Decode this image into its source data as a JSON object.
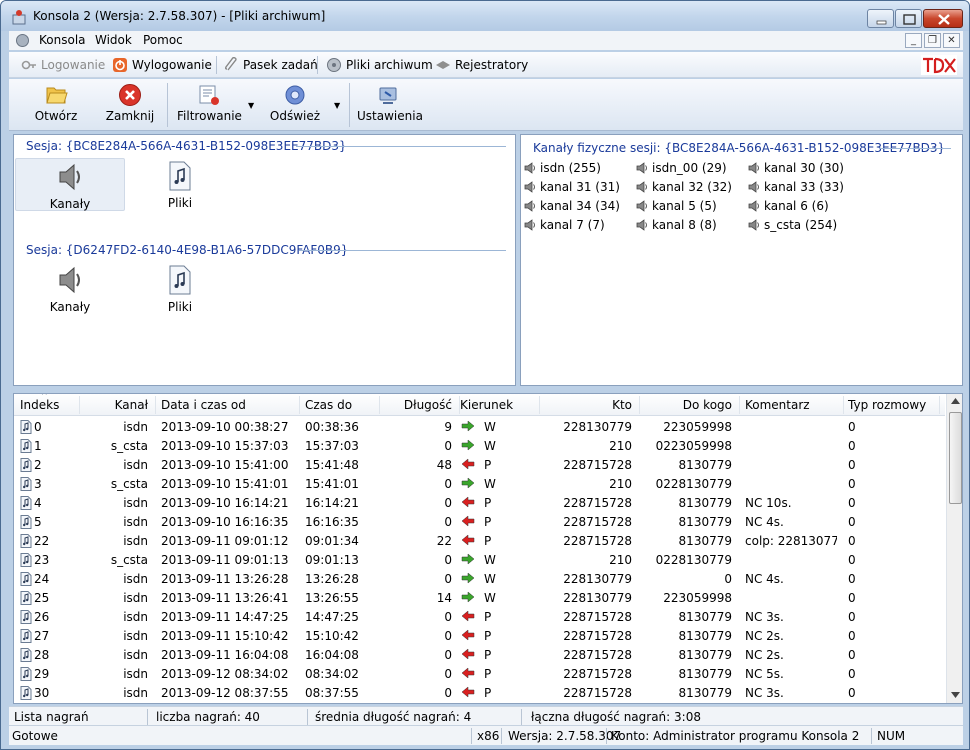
{
  "window": {
    "title": "Konsola 2 (Wersja:  2.7.58.307) - [Pliki archiwum]"
  },
  "menu": {
    "items": [
      "Konsola",
      "Widok",
      "Pomoc"
    ]
  },
  "toolbar1": {
    "login": "Logowanie",
    "logout": "Wylogowanie",
    "taskbar": "Pasek zadań",
    "archive": "Pliki archiwum",
    "recorders": "Rejestratory"
  },
  "toolbar2": {
    "open": "Otwórz",
    "close": "Zamknij",
    "filter": "Filtrowanie",
    "refresh": "Odśwież",
    "settings": "Ustawienia"
  },
  "sessions": [
    {
      "header": "Sesja: {BC8E284A-566A-4631-B152-098E3EE77BD3}",
      "channels": "Kanały",
      "files": "Pliki"
    },
    {
      "header": "Sesja: {D6247FD2-6140-4E98-B1A6-57DDC9FAF0B9}",
      "channels": "Kanały",
      "files": "Pliki"
    }
  ],
  "physical": {
    "header": "Kanały fizyczne sesji: {BC8E284A-566A-4631-B152-098E3EE77BD3}",
    "channels": [
      "isdn (255)",
      "isdn_00 (29)",
      "kanal 30 (30)",
      "kanal 31 (31)",
      "kanal 32 (32)",
      "kanal 33 (33)",
      "kanal 34 (34)",
      "kanal 5 (5)",
      "kanal 6 (6)",
      "kanal 7 (7)",
      "kanal 8 (8)",
      "s_csta (254)"
    ]
  },
  "table": {
    "headers": [
      "Indeks",
      "Kanał",
      "Data i czas od",
      "Czas do",
      "Długość",
      "Kierunek",
      "Kto",
      "Do kogo",
      "Komentarz",
      "Typ rozmowy"
    ],
    "rows": [
      [
        "0",
        "isdn",
        "2013-09-10 00:38:27",
        "00:38:36",
        "9",
        "W",
        "228130779",
        "223059998",
        "",
        "0"
      ],
      [
        "1",
        "s_csta",
        "2013-09-10 15:37:03",
        "15:37:03",
        "0",
        "W",
        "210",
        "0223059998",
        "",
        "0"
      ],
      [
        "2",
        "isdn",
        "2013-09-10 15:41:00",
        "15:41:48",
        "48",
        "P",
        "228715728",
        "8130779",
        "",
        "0"
      ],
      [
        "3",
        "s_csta",
        "2013-09-10 15:41:01",
        "15:41:01",
        "0",
        "W",
        "210",
        "0228130779",
        "",
        "0"
      ],
      [
        "4",
        "isdn",
        "2013-09-10 16:14:21",
        "16:14:21",
        "0",
        "P",
        "228715728",
        "8130779",
        "NC 10s.",
        "0"
      ],
      [
        "5",
        "isdn",
        "2013-09-10 16:16:35",
        "16:16:35",
        "0",
        "P",
        "228715728",
        "8130779",
        "NC 4s.",
        "0"
      ],
      [
        "22",
        "isdn",
        "2013-09-11 09:01:12",
        "09:01:34",
        "22",
        "P",
        "228715728",
        "8130779",
        "colp: 22813077...",
        "0"
      ],
      [
        "23",
        "s_csta",
        "2013-09-11 09:01:13",
        "09:01:13",
        "0",
        "W",
        "210",
        "0228130779",
        "",
        "0"
      ],
      [
        "24",
        "isdn",
        "2013-09-11 13:26:28",
        "13:26:28",
        "0",
        "W",
        "228130779",
        "0",
        "NC 4s.",
        "0"
      ],
      [
        "25",
        "isdn",
        "2013-09-11 13:26:41",
        "13:26:55",
        "14",
        "W",
        "228130779",
        "223059998",
        "",
        "0"
      ],
      [
        "26",
        "isdn",
        "2013-09-11 14:47:25",
        "14:47:25",
        "0",
        "P",
        "228715728",
        "8130779",
        "NC 3s.",
        "0"
      ],
      [
        "27",
        "isdn",
        "2013-09-11 15:10:42",
        "15:10:42",
        "0",
        "P",
        "228715728",
        "8130779",
        "NC 2s.",
        "0"
      ],
      [
        "28",
        "isdn",
        "2013-09-11 16:04:08",
        "16:04:08",
        "0",
        "P",
        "228715728",
        "8130779",
        "NC 2s.",
        "0"
      ],
      [
        "29",
        "isdn",
        "2013-09-12 08:34:02",
        "08:34:02",
        "0",
        "P",
        "228715728",
        "8130779",
        "NC 5s.",
        "0"
      ],
      [
        "30",
        "isdn",
        "2013-09-12 08:37:55",
        "08:37:55",
        "0",
        "P",
        "228715728",
        "8130779",
        "NC 3s.",
        "0"
      ]
    ]
  },
  "status1": {
    "label": "Lista nagrań",
    "count": "liczba nagrań:  40",
    "avg": "średnia długość nagrań:  4",
    "total": "łączna długość nagrań:  3:08"
  },
  "status2": {
    "ready": "Gotowe",
    "arch": "x86",
    "version": "Wersja: 2.7.58.307",
    "account": "Konto: Administrator programu Konsola 2",
    "num": "NUM"
  },
  "colors": {
    "in_arrow": "#3aa62c",
    "out_arrow": "#d92020",
    "group_header": "#1a3a9a"
  }
}
